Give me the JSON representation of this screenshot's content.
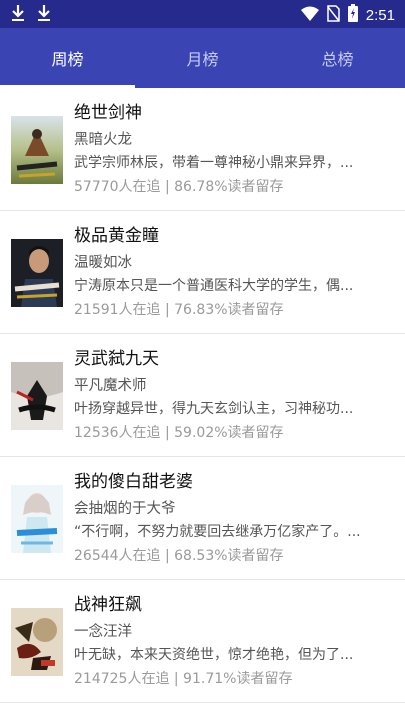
{
  "status_bar": {
    "time": "2:51",
    "left_icons": [
      "download-icon",
      "download-icon"
    ],
    "right_icons": [
      "wifi-icon",
      "no-sim-icon",
      "battery-icon"
    ]
  },
  "tabs": [
    {
      "label": "周榜",
      "active": true
    },
    {
      "label": "月榜",
      "active": false
    },
    {
      "label": "总榜",
      "active": false
    }
  ],
  "books": [
    {
      "title": "绝世剑神",
      "author": "黑暗火龙",
      "desc": "武学宗师林辰，带着一尊神秘小鼎来异界，...",
      "stats": "57770人在追 | 86.78%读者留存"
    },
    {
      "title": "极品黄金瞳",
      "author": "温暖如冰",
      "desc": "宁涛原本只是一个普通医科大学的学生，偶...",
      "stats": "21591人在追 | 76.83%读者留存"
    },
    {
      "title": "灵武弑九天",
      "author": "平凡魔术师",
      "desc": "叶扬穿越异世，得九天玄剑认主，习神秘功...",
      "stats": "12536人在追 | 59.02%读者留存"
    },
    {
      "title": "我的傻白甜老婆",
      "author": "会抽烟的于大爷",
      "desc": "“不行啊，不努力就要回去继承万亿家产了。...",
      "stats": "26544人在追 | 68.53%读者留存"
    },
    {
      "title": "战神狂飙",
      "author": "一念汪洋",
      "desc": "叶无缺，本来天资绝世，惊才绝艳，但为了...",
      "stats": "214725人在追 | 91.71%读者留存"
    }
  ],
  "colors": {
    "status_bar": "#252a8c",
    "tab_bar": "#3a44b3",
    "tab_active": "#ffffff",
    "tab_inactive": "#c7cbf3"
  }
}
